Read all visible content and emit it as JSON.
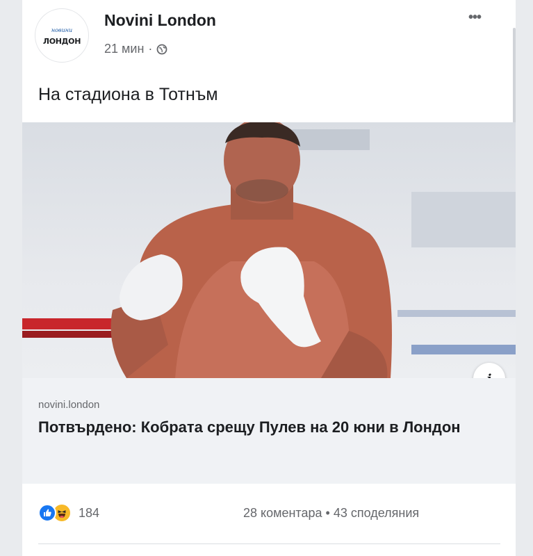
{
  "post": {
    "page_name": "Novini London",
    "avatar_script": "новини",
    "avatar_word": "ЛОНДОН",
    "time": "21 мин",
    "separator": "·",
    "more_label": "•••",
    "text": "На стадиона в Тотнъм"
  },
  "link": {
    "info_label": "i",
    "domain": "novini.london",
    "headline": "Потвърдено: Кобрата срещу Пулев на 20 юни в Лондон"
  },
  "reactions": {
    "count": "184",
    "comments": "28 коментара",
    "dot": "•",
    "shares": "43 споделяния"
  },
  "colors": {
    "like": "#1877f2",
    "haha": "#f7b928",
    "secondary_text": "#65676b"
  },
  "icons": [
    "globe-icon",
    "more-icon",
    "like-icon",
    "haha-icon",
    "info-icon"
  ]
}
